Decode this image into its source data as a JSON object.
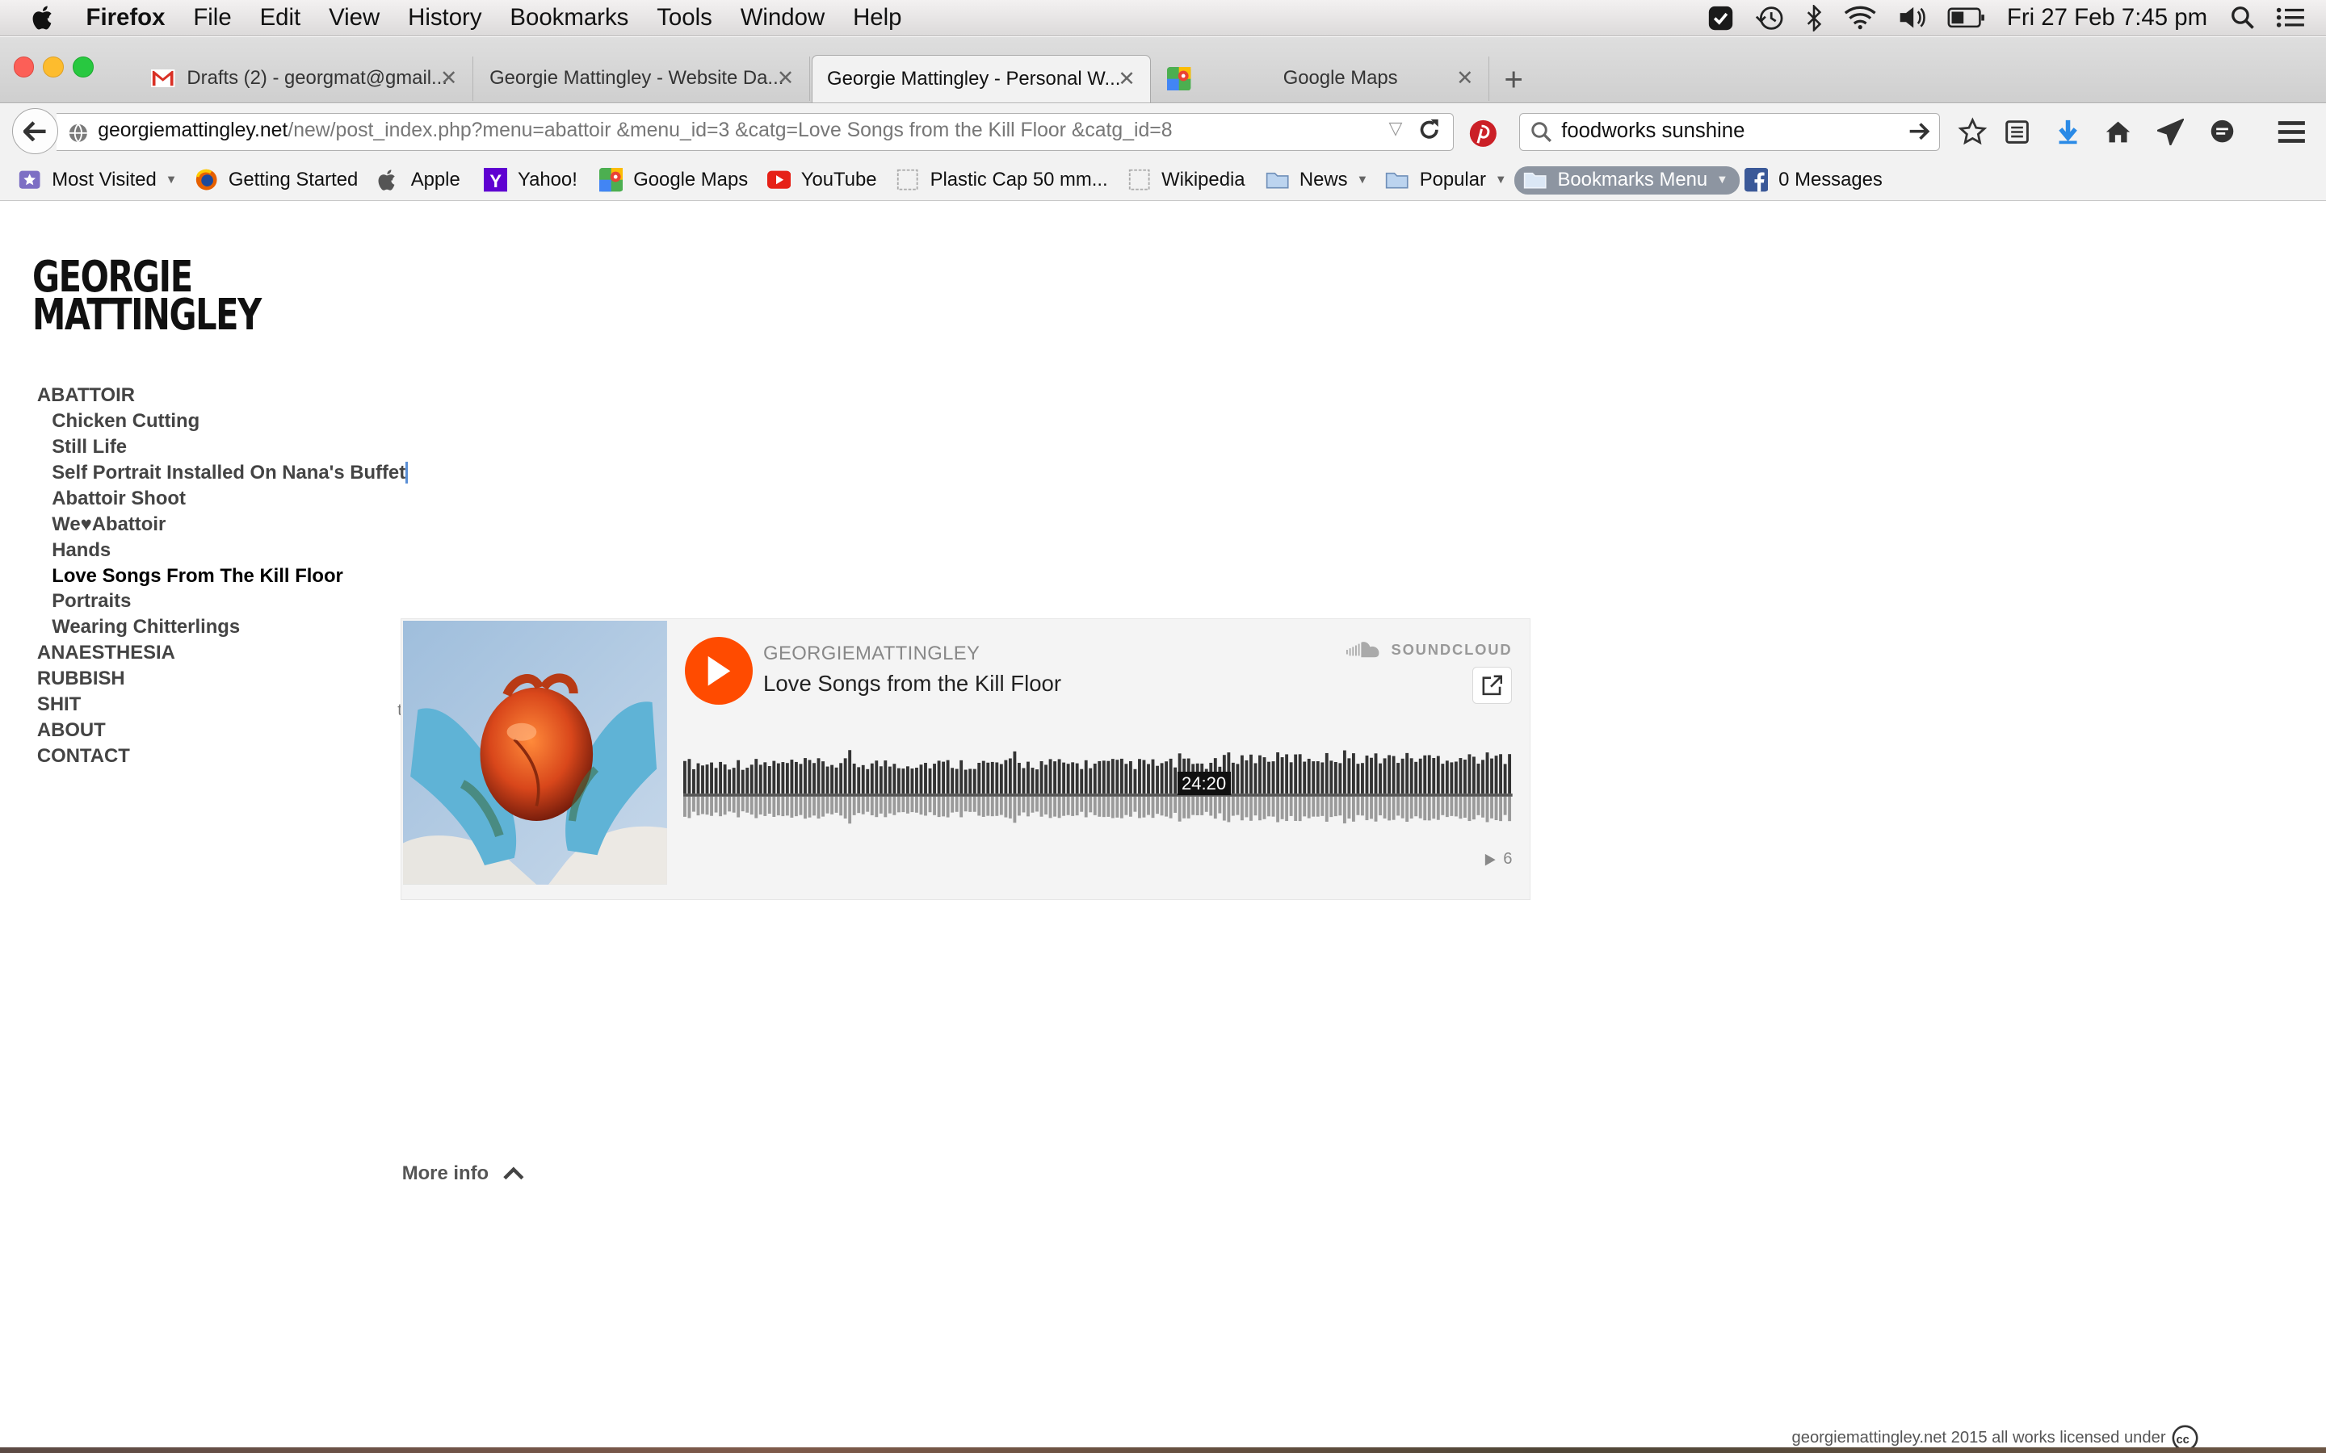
{
  "menubar": {
    "app_name": "Firefox",
    "menus": [
      "File",
      "Edit",
      "View",
      "History",
      "Bookmarks",
      "Tools",
      "Window",
      "Help"
    ],
    "clock": "Fri 27 Feb  7:45 pm"
  },
  "tabs": [
    {
      "label": "Drafts (2) - georgmat@gmail...",
      "icon": "gmail-icon"
    },
    {
      "label": "Georgie Mattingley - Website Da...",
      "icon": ""
    },
    {
      "label": "Georgie Mattingley - Personal W...",
      "icon": "",
      "active": true
    },
    {
      "label": "Google Maps",
      "icon": "google-maps-icon"
    }
  ],
  "toolbar": {
    "url_host": "georgiemattingley.net",
    "url_path": "/new/post_index.php?menu=abattoir &menu_id=3 &catg=Love Songs from the Kill Floor &catg_id=8",
    "search_value": "foodworks sunshine"
  },
  "bookmarks": [
    {
      "label": "Most Visited",
      "icon": "most-visited-icon",
      "dropdown": true
    },
    {
      "label": "Getting Started",
      "icon": "firefox-icon"
    },
    {
      "label": "Apple",
      "icon": "apple-icon"
    },
    {
      "label": "Yahoo!",
      "icon": "yahoo-icon"
    },
    {
      "label": "Google Maps",
      "icon": "google-maps-icon"
    },
    {
      "label": "YouTube",
      "icon": "youtube-icon"
    },
    {
      "label": "Plastic Cap 50 mm...",
      "icon": "page-icon"
    },
    {
      "label": "Wikipedia",
      "icon": "page-icon"
    },
    {
      "label": "News",
      "icon": "folder-icon",
      "dropdown": true
    },
    {
      "label": "Popular",
      "icon": "folder-icon",
      "dropdown": true
    },
    {
      "label": "Bookmarks Menu",
      "icon": "folder-icon",
      "dropdown": true
    },
    {
      "label": "0 Messages",
      "icon": "facebook-icon"
    }
  ],
  "site": {
    "logo_line1": "GEORGIE",
    "logo_line2": "MATTINGLEY",
    "nav": {
      "abattoir": "ABATTOIR",
      "abattoir_items": [
        "Chicken Cutting",
        "Still Life",
        "Self Portrait Installed On Nana's Buffet",
        "Abattoir Shoot",
        "We♥Abattoir",
        "Hands",
        "Love Songs From The Kill Floor",
        "Portraits",
        "Wearing Chitterlings"
      ],
      "current_item": "Love Songs From The Kill Floor",
      "others": [
        "ANAESTHESIA",
        "RUBBISH",
        "SHIT",
        "ABOUT",
        "CONTACT"
      ]
    },
    "player": {
      "artist": "GEORGIEMATTINGLEY",
      "track_title": "Love Songs from the Kill Floor",
      "brand": "SOUNDCLOUD",
      "duration": "24:20",
      "plays": "6",
      "stray_char": "t"
    },
    "more_info": "More info",
    "footer": "georgiemattingley.net 2015 all works licensed under",
    "colors": {
      "soundcloud_orange": "#ff4b00",
      "nav_text": "#444444"
    }
  }
}
